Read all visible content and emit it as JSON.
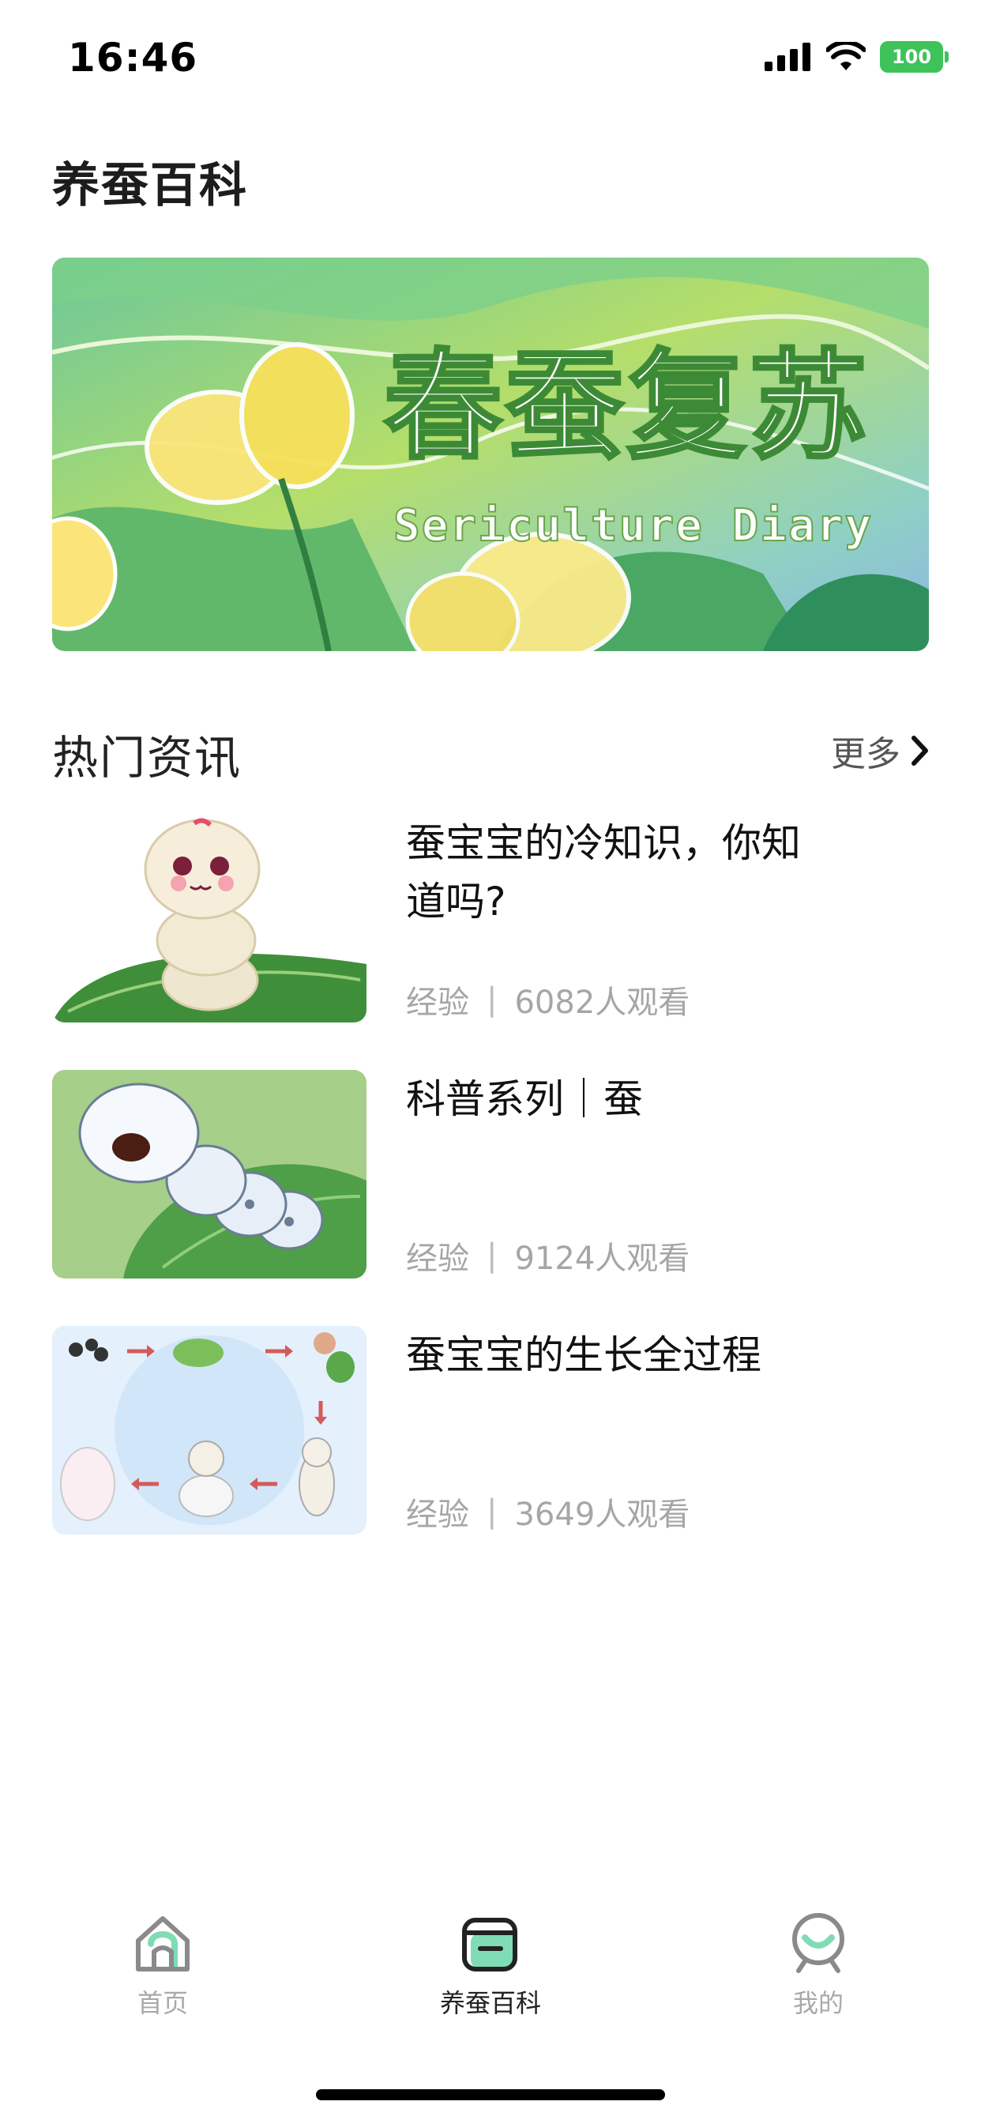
{
  "status_bar": {
    "time": "16:46",
    "battery": "100"
  },
  "page": {
    "title": "养蚕百科"
  },
  "banner": {
    "title": "春蚕复苏",
    "subtitle": "Sericulture Diary"
  },
  "section": {
    "title": "热门资讯",
    "more_label": "更多"
  },
  "news": [
    {
      "title": "蚕宝宝的冷知识，你知道吗?",
      "category": "经验",
      "views": "6082人观看"
    },
    {
      "title": "科普系列｜蚕",
      "category": "经验",
      "views": "9124人观看"
    },
    {
      "title": "蚕宝宝的生长全过程",
      "category": "经验",
      "views": "3649人观看"
    }
  ],
  "tabs": [
    {
      "label": "首页",
      "icon": "home-icon"
    },
    {
      "label": "养蚕百科",
      "icon": "encyclopedia-icon"
    },
    {
      "label": "我的",
      "icon": "profile-icon"
    }
  ],
  "colors": {
    "accent": "#3ec35a",
    "mint": "#7fdcb4",
    "text_primary": "#111111",
    "text_meta": "#a6a6a6"
  }
}
